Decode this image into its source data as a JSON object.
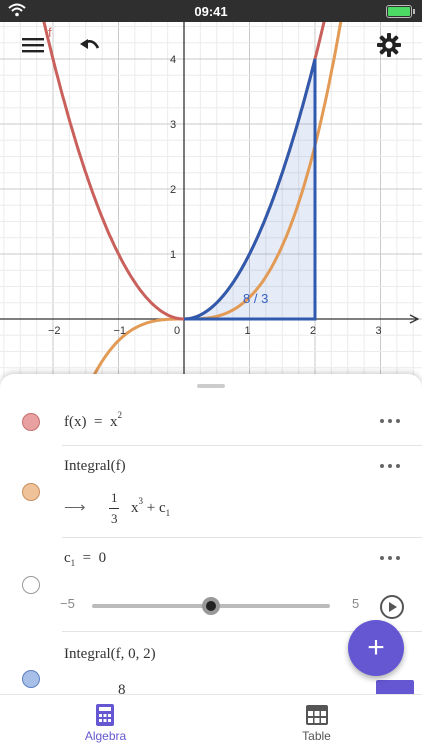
{
  "status": {
    "time": "09:41"
  },
  "graph": {
    "x_ticks": [
      "−2",
      "−1",
      "0",
      "1",
      "2",
      "3"
    ],
    "y_ticks": [
      "1",
      "2",
      "3",
      "4"
    ],
    "f_label": "f",
    "area_label": "8 / 3",
    "colors": {
      "f": "#c0504d",
      "integral": "#e29a55",
      "area": "#2f5aad"
    }
  },
  "algebra": {
    "items": [
      {
        "lhs": "f(x)",
        "eq": "=",
        "rhs": "x",
        "rhs_exp": "2"
      },
      {
        "title": "Integral(f)",
        "arrow": "⟶",
        "frac_num": "1",
        "frac_den": "3",
        "term": "x",
        "term_exp": "3",
        "plus": "+",
        "c": "c",
        "c_sub": "1"
      },
      {
        "c": "c",
        "c_sub": "1",
        "eq": "=",
        "value": "0",
        "min": "−5",
        "max": "5"
      },
      {
        "title": "Integral(f, 0, 2)",
        "result": "8"
      }
    ],
    "dot_colors": [
      "#e8a0a0",
      "#f0c29a",
      "#ffffff",
      "#a8c0e8"
    ]
  },
  "tabs": {
    "algebra": "Algebra",
    "table": "Table"
  }
}
